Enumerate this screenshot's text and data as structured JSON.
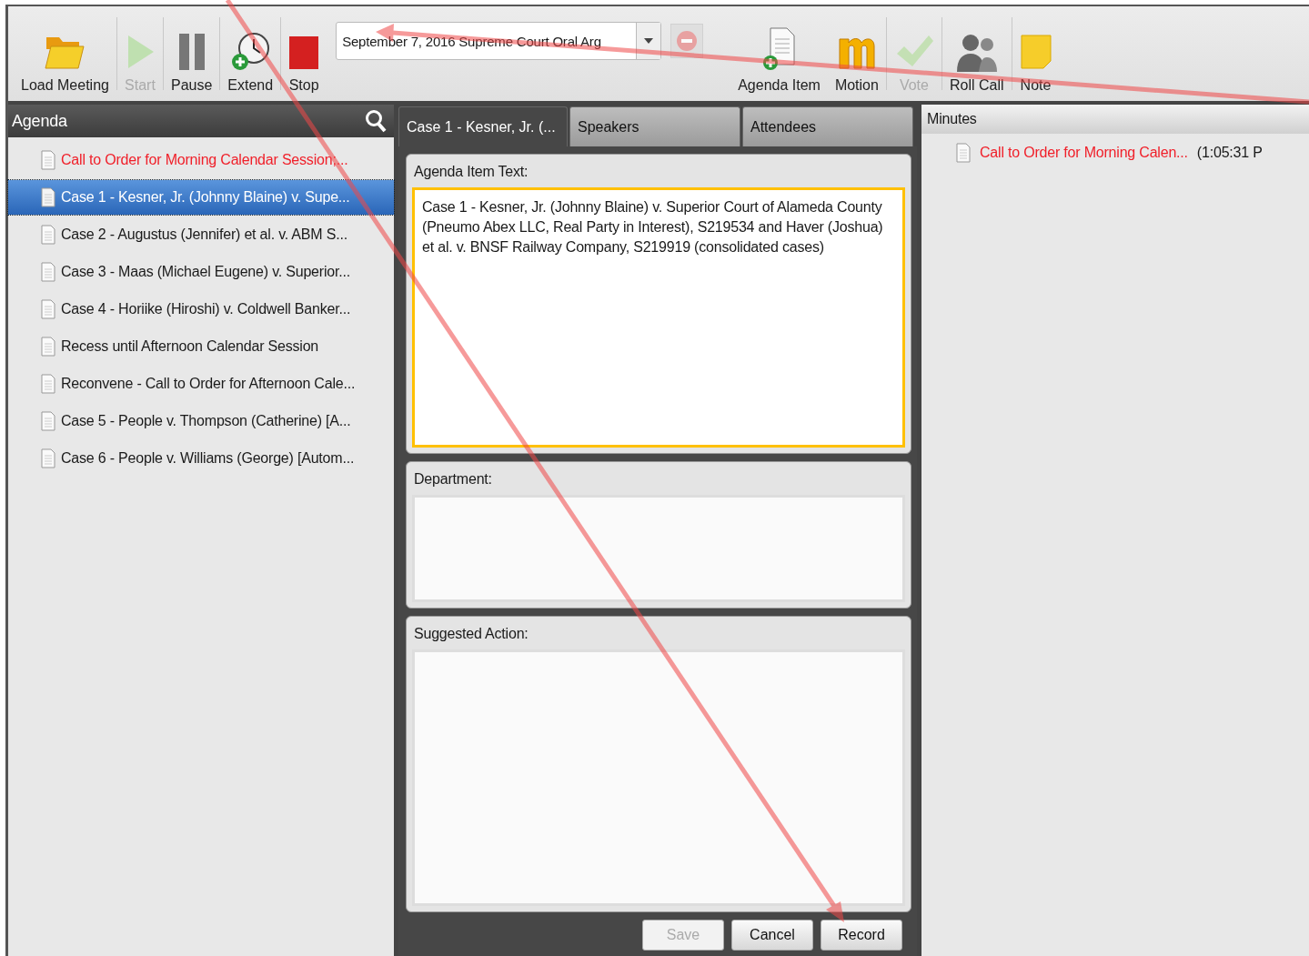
{
  "toolbar": [
    {
      "kind": "button",
      "label": "Load Meeting",
      "disabled": false
    },
    {
      "kind": "button",
      "label": "Start",
      "disabled": true
    },
    {
      "kind": "button",
      "label": "Pause",
      "disabled": false
    },
    {
      "kind": "button",
      "label": "Extend",
      "disabled": false
    },
    {
      "kind": "button",
      "label": "Stop",
      "disabled": false
    },
    {
      "kind": "dropdown",
      "value": "September 7, 2016 Supreme Court Oral Arg"
    },
    {
      "kind": "icon-button",
      "disabled": true
    },
    {
      "kind": "button",
      "label": "Agenda Item",
      "disabled": false
    },
    {
      "kind": "button",
      "label": "Motion",
      "disabled": false
    },
    {
      "kind": "button",
      "label": "Vote",
      "disabled": true
    },
    {
      "kind": "button",
      "label": "Roll Call",
      "disabled": false
    },
    {
      "kind": "button",
      "label": "Note",
      "disabled": false
    }
  ],
  "agenda": {
    "title": "Agenda",
    "items": [
      {
        "text": "Call to Order for Morning Calendar Session;...",
        "selected": false,
        "highlighted": true
      },
      {
        "text": "Case 1 - Kesner, Jr. (Johnny Blaine) v. Supe...",
        "selected": true,
        "highlighted": false
      },
      {
        "text": "Case 2 - Augustus (Jennifer) et al. v. ABM S...",
        "selected": false,
        "highlighted": false
      },
      {
        "text": "Case 3 - Maas (Michael Eugene) v. Superior...",
        "selected": false,
        "highlighted": false
      },
      {
        "text": "Case 4 - Horiike (Hiroshi) v. Coldwell Banker...",
        "selected": false,
        "highlighted": false
      },
      {
        "text": "Recess until Afternoon Calendar Session",
        "selected": false,
        "highlighted": false
      },
      {
        "text": "Reconvene - Call to Order for Afternoon Cale...",
        "selected": false,
        "highlighted": false
      },
      {
        "text": "Case 5 - People v. Thompson (Catherine) [A...",
        "selected": false,
        "highlighted": false
      },
      {
        "text": "Case 6 - People v. Williams (George) [Autom...",
        "selected": false,
        "highlighted": false
      }
    ]
  },
  "tabs": [
    {
      "label": "Case 1 - Kesner, Jr. (...",
      "selected": true
    },
    {
      "label": "Speakers",
      "selected": false
    },
    {
      "label": "Attendees",
      "selected": false
    }
  ],
  "fields": [
    {
      "label": "Agenda Item Text:",
      "value": "Case 1 - Kesner, Jr. (Johnny Blaine) v. Superior Court of Alameda County (Pneumo Abex LLC, Real Party in Interest), S219534 and Haver (Joshua) et al. v. BNSF Railway Company, S219919 (consolidated cases)",
      "focused": true
    },
    {
      "label": "Department:",
      "focused": false
    },
    {
      "label": "Suggested Action:",
      "focused": false
    }
  ],
  "buttons": [
    {
      "label": "Save",
      "disabled": true
    },
    {
      "label": "Cancel",
      "disabled": false
    },
    {
      "label": "Record",
      "disabled": false
    }
  ],
  "minutes": {
    "title": "Minutes",
    "entries": [
      {
        "text": "Call to Order for Morning Calen...",
        "time": "(1:05:31 P",
        "highlighted": true
      }
    ]
  }
}
